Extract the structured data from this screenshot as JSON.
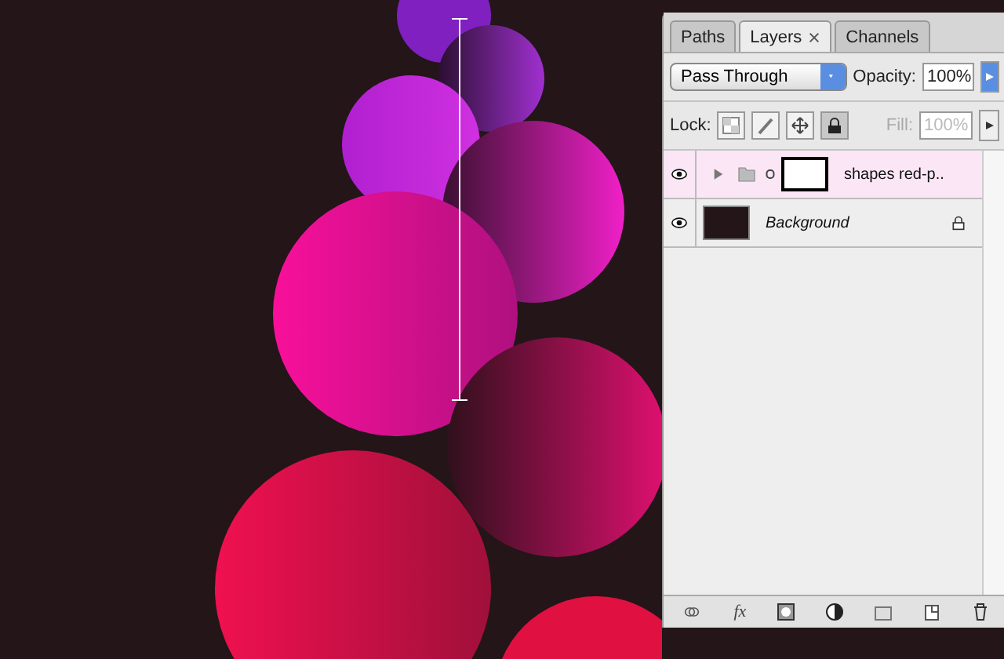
{
  "panel": {
    "tabs": [
      {
        "label": "Paths",
        "selected": false
      },
      {
        "label": "Layers",
        "selected": true,
        "closable": true
      },
      {
        "label": "Channels",
        "selected": false
      }
    ],
    "blend_mode": "Pass Through",
    "opacity_label": "Opacity:",
    "opacity": "100%",
    "lock_label": "Lock:",
    "locks": [
      {
        "kind": "pixels",
        "selected": false
      },
      {
        "kind": "paint",
        "selected": false
      },
      {
        "kind": "move",
        "selected": false
      },
      {
        "kind": "all",
        "selected": true
      }
    ],
    "fill_label": "Fill:",
    "fill": "100%",
    "fill_disabled": true,
    "layers": [
      {
        "kind": "group",
        "name": "shapes red-p..",
        "visible": true,
        "selected": true,
        "expanded": false,
        "locked": false
      },
      {
        "kind": "pixel",
        "name": "Background",
        "visible": true,
        "selected": false,
        "locked": true
      }
    ],
    "footer": {
      "fx": "fx"
    }
  }
}
